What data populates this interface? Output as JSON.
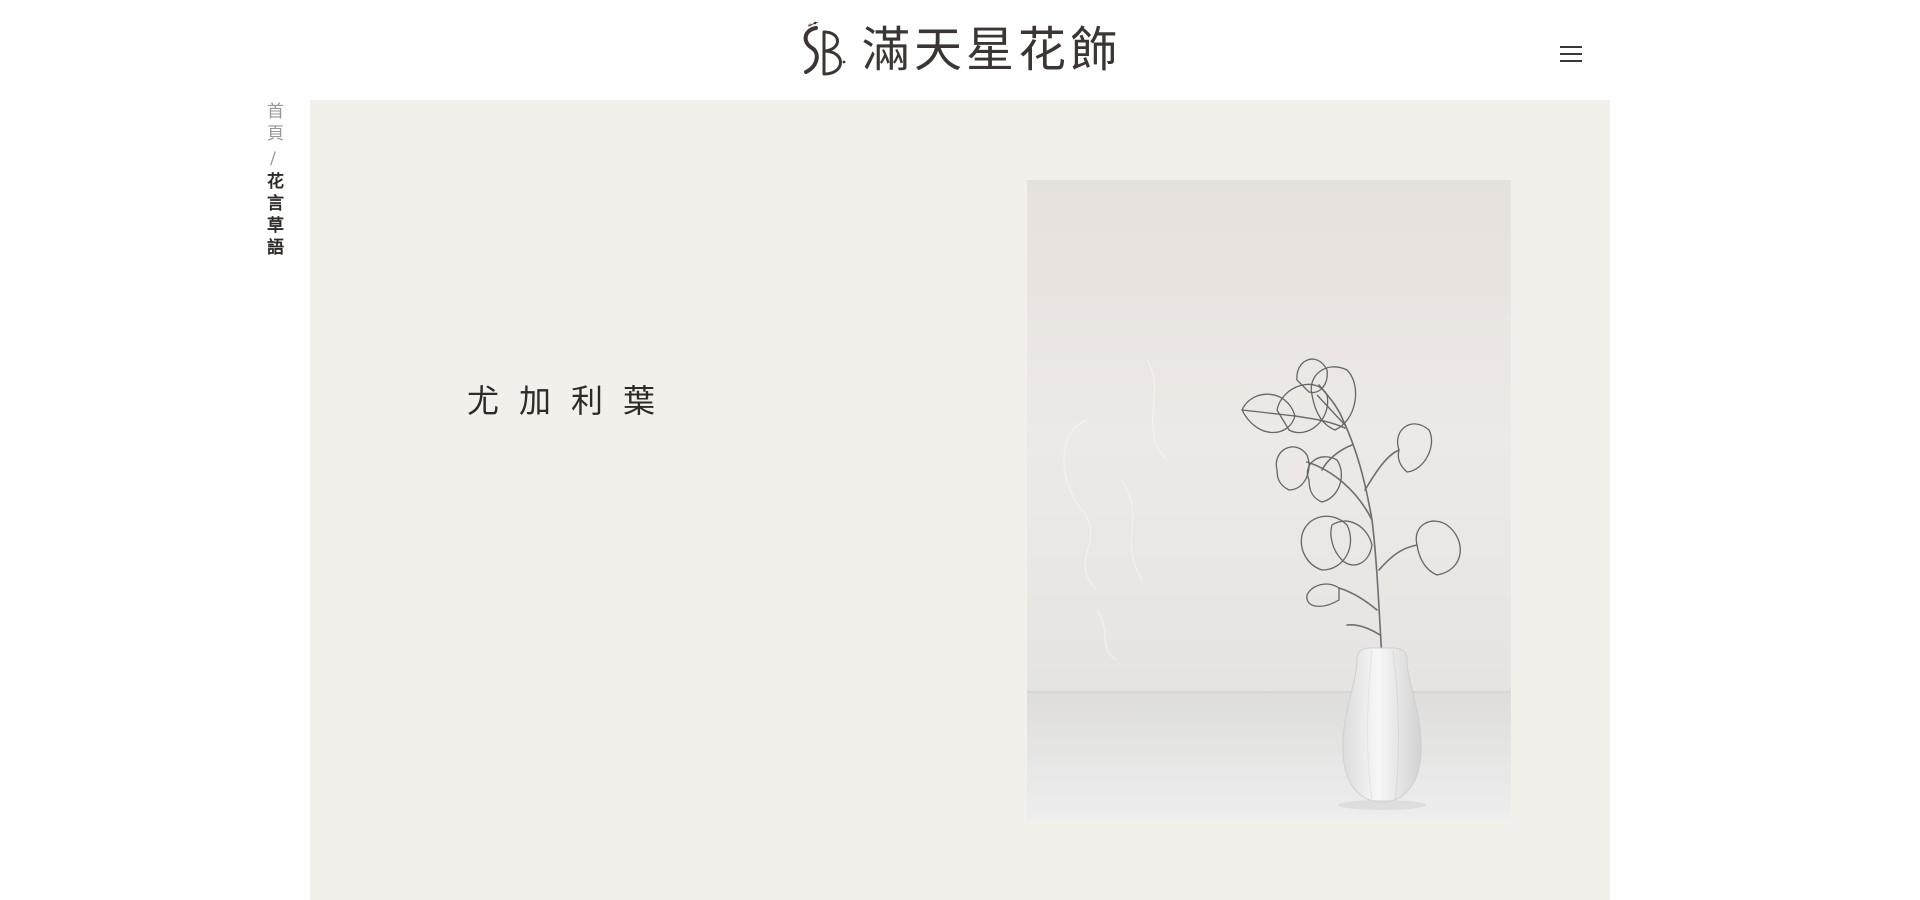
{
  "header": {
    "logo_monogram": "SB",
    "logo_text": "滿天星花飾",
    "menu_icon": "hamburger-menu-icon"
  },
  "breadcrumb": {
    "home": "首頁",
    "separator": "/",
    "current": "花言草語"
  },
  "hero": {
    "title": "尤加利葉",
    "image_icon": "eucalyptus-vase-illustration"
  },
  "colors": {
    "text_dark": "#2e2a27",
    "text_muted": "#9a9592",
    "panel_background": "#f3f0ec",
    "logo_accent": "#d99a8a",
    "page_background": "#ffffff"
  }
}
